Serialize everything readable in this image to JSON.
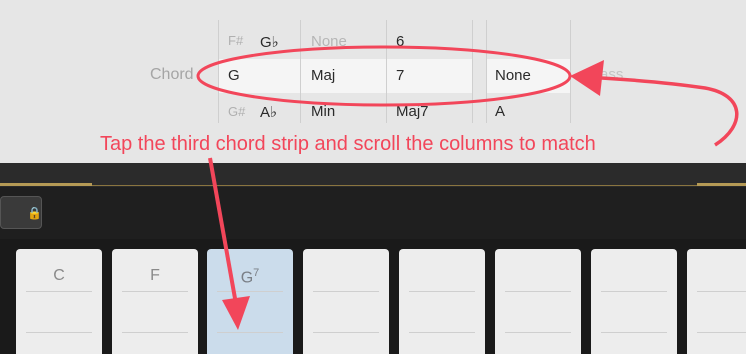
{
  "picker": {
    "label": "Chord",
    "root": {
      "above": "F#",
      "above_flat": "G♭",
      "selected": "G",
      "below": "G#",
      "below_flat": "A♭"
    },
    "quality": {
      "above": "None",
      "selected": "Maj",
      "below": "Min"
    },
    "extension": {
      "above": "6",
      "selected": "7",
      "below": "Maj7"
    },
    "bass": {
      "selected": "None",
      "below": "A",
      "header_faded": "Bass"
    }
  },
  "keyboard": {
    "lock_icon": "🔒",
    "strips": [
      {
        "label": "C"
      },
      {
        "label": "F"
      },
      {
        "label": "G",
        "superscript": "7"
      },
      {
        "label": ""
      },
      {
        "label": ""
      },
      {
        "label": ""
      },
      {
        "label": ""
      },
      {
        "label": ""
      }
    ]
  },
  "annotation": {
    "text": "Tap the third chord strip and scroll the columns to match",
    "color": "#f2465a"
  }
}
